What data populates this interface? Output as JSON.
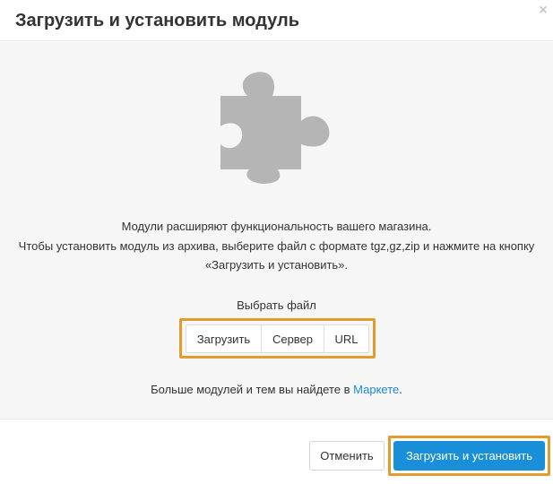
{
  "modal": {
    "title": "Загрузить и установить модуль",
    "close_symbol": "×"
  },
  "hero": {
    "icon": "puzzle-piece-icon",
    "icon_color": "#b5b5b5",
    "description_line1": "Модули расширяют функциональность вашего магазина.",
    "description_line2": "Чтобы установить модуль из архива, выберите файл с формате tgz,gz,zip и нажмите на кнопку",
    "description_line3": "«Загрузить и установить»."
  },
  "file_source": {
    "label": "Выбрать файл",
    "options": [
      "Загрузить",
      "Сервер",
      "URL"
    ]
  },
  "more": {
    "text": "Больше модулей и тем вы найдете в ",
    "link_text": "Маркете",
    "suffix": "."
  },
  "footer": {
    "cancel_label": "Отменить",
    "submit_label": "Загрузить и установить"
  },
  "colors": {
    "accent_blue": "#1a8fd9",
    "link_blue": "#1e88d6",
    "highlight_orange": "#e39b2b"
  }
}
